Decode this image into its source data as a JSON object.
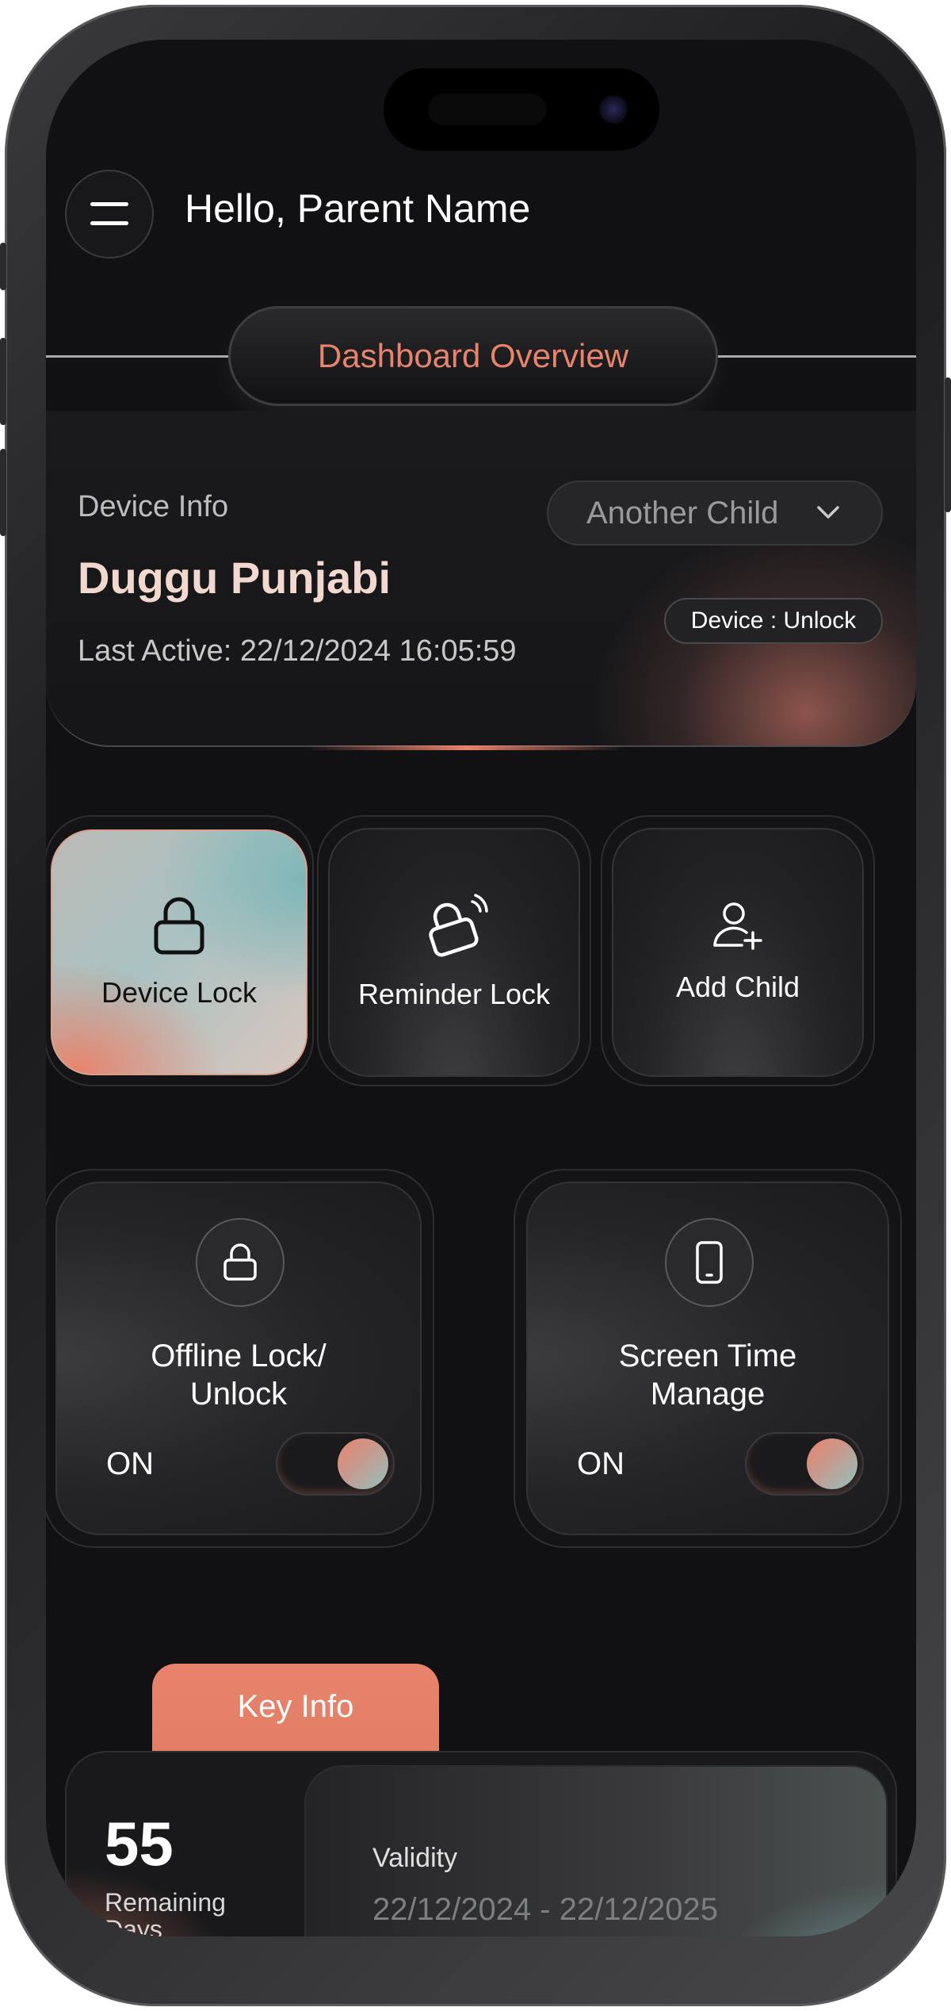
{
  "header": {
    "greeting": "Hello, Parent Name",
    "section_title": "Dashboard Overview"
  },
  "device_info": {
    "label": "Device Info",
    "child_name": "Duggu Punjabi",
    "last_active": "Last Active: 22/12/2024  16:05:59",
    "child_selector": "Another Child",
    "status_badge": "Device : Unlock"
  },
  "actions": [
    {
      "label": "Device Lock",
      "icon": "lock-icon",
      "active": true
    },
    {
      "label": "Reminder Lock",
      "icon": "reminder-lock-icon",
      "active": false
    },
    {
      "label": "Add Child",
      "icon": "add-user-icon",
      "active": false
    }
  ],
  "toggles": [
    {
      "title_line1": "Offline Lock/",
      "title_line2": "Unlock",
      "state": "ON",
      "icon": "lock-icon"
    },
    {
      "title_line1": "Screen Time",
      "title_line2": "Manage",
      "state": "ON",
      "icon": "phone-icon"
    }
  ],
  "key_info": {
    "tab_label": "Key Info",
    "remaining_days": "55",
    "remaining_label": "Remaining Days",
    "validity_label": "Validity",
    "validity_range": "22/12/2024 - 22/12/2025"
  },
  "colors": {
    "accent": "#e8836c",
    "teal": "#7fb6b7",
    "background": "#111113"
  }
}
